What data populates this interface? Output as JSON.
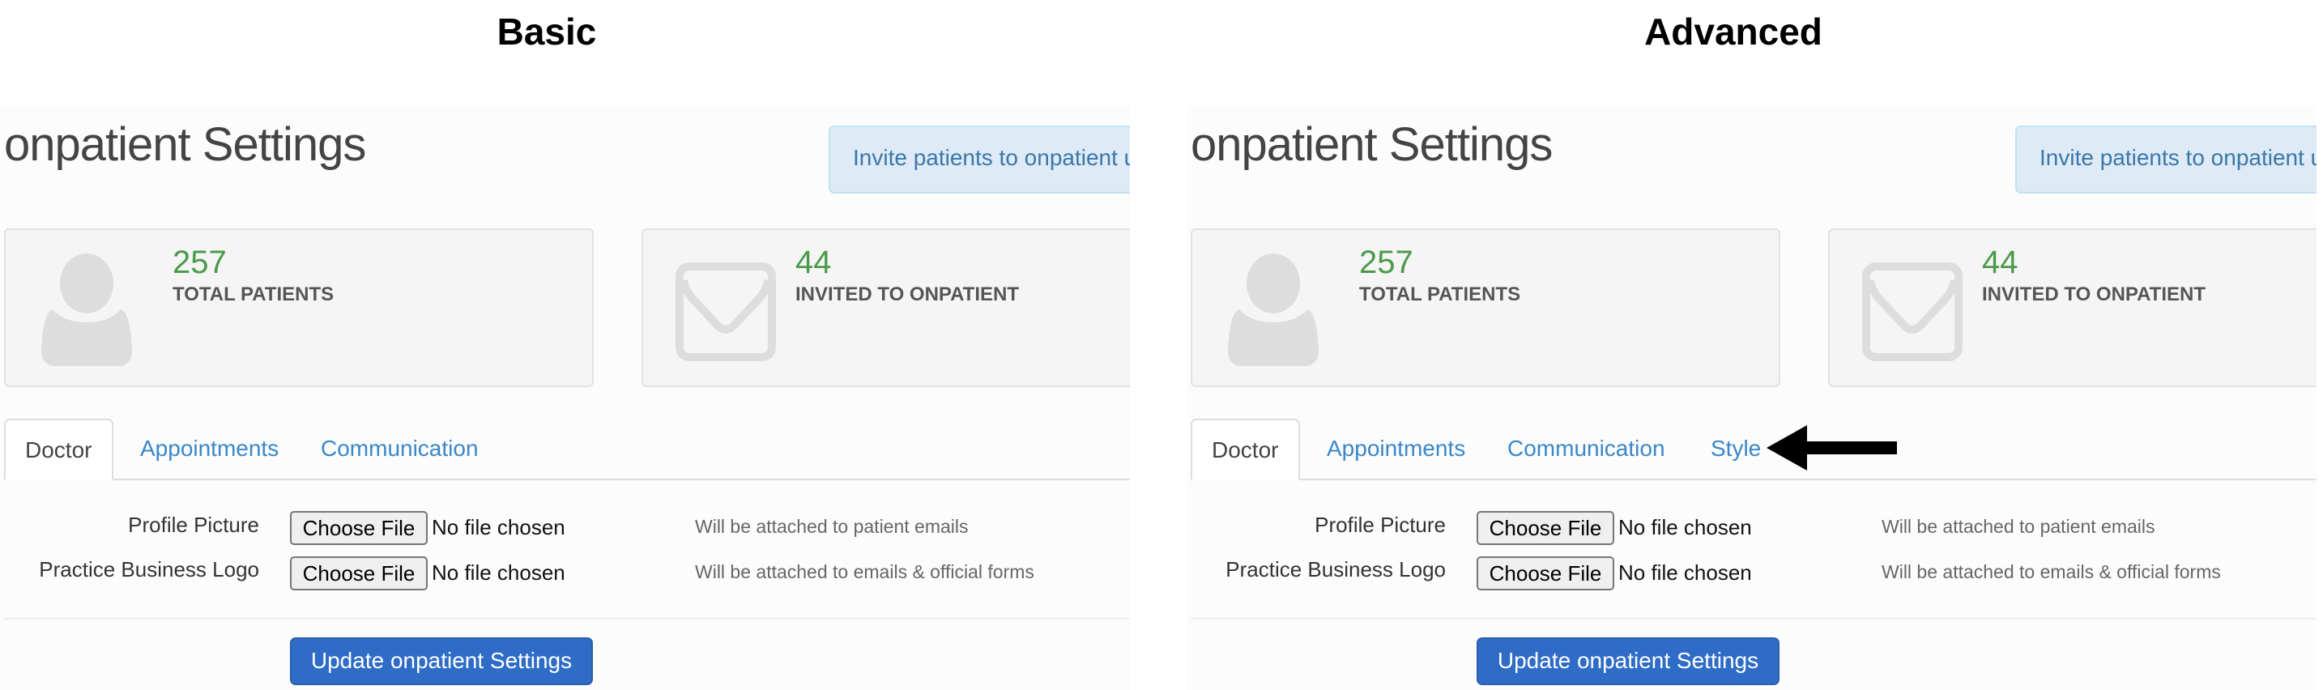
{
  "captions": {
    "left": "Basic",
    "right": "Advanced"
  },
  "panels": {
    "basic": {
      "page_title": "onpatient Settings",
      "invite_alert": "Invite patients to onpatient u",
      "stats": [
        {
          "value": "257",
          "label": "TOTAL PATIENTS",
          "icon": "user-silhouette-icon"
        },
        {
          "value": "44",
          "label": "INVITED TO ONPATIENT",
          "icon": "envelope-icon"
        }
      ],
      "tabs": [
        {
          "label": "Doctor",
          "active": true
        },
        {
          "label": "Appointments",
          "active": false
        },
        {
          "label": "Communication",
          "active": false
        }
      ],
      "rows": [
        {
          "label": "Profile Picture",
          "button": "Choose File",
          "status": "No file chosen",
          "help": "Will be attached to patient emails"
        },
        {
          "label": "Practice Business Logo",
          "button": "Choose File",
          "status": "No file chosen",
          "help": "Will be attached to emails & official forms"
        }
      ],
      "submit_label": "Update onpatient Settings"
    },
    "advanced": {
      "page_title": "onpatient Settings",
      "invite_alert": "Invite patients to onpatient u",
      "stats": [
        {
          "value": "257",
          "label": "TOTAL PATIENTS",
          "icon": "user-silhouette-icon"
        },
        {
          "value": "44",
          "label": "INVITED TO ONPATIENT",
          "icon": "envelope-icon"
        }
      ],
      "tabs": [
        {
          "label": "Doctor",
          "active": true
        },
        {
          "label": "Appointments",
          "active": false
        },
        {
          "label": "Communication",
          "active": false
        },
        {
          "label": "Style",
          "active": false
        }
      ],
      "rows": [
        {
          "label": "Profile Picture",
          "button": "Choose File",
          "status": "No file chosen",
          "help": "Will be attached to patient emails"
        },
        {
          "label": "Practice Business Logo",
          "button": "Choose File",
          "status": "No file chosen",
          "help": "Will be attached to emails & official forms"
        }
      ],
      "submit_label": "Update onpatient Settings",
      "annotation": "arrow-pointing-to-style-tab"
    }
  },
  "colors": {
    "link_blue": "#3a87c9",
    "stat_green": "#4b9a4b",
    "primary_button": "#2e6cc7",
    "alert_bg": "#deebf6",
    "alert_text": "#3a77a8"
  }
}
